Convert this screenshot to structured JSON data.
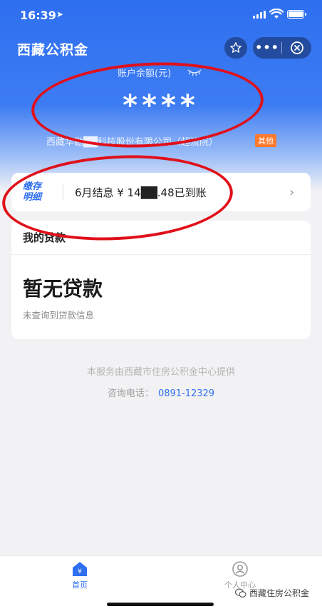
{
  "status_bar": {
    "time": "16:39",
    "location_glyph": "➤"
  },
  "header": {
    "title": "西藏公积金",
    "more_label": "•••"
  },
  "balance": {
    "label": "账户余额(元)",
    "value": "****",
    "company": "西藏华勘██科技股份有限公司（超流院）",
    "tag": "其他"
  },
  "deposit": {
    "badge_line1": "缴存",
    "badge_line2": "明细",
    "text": "6月结息 ¥ 14██.48已到账",
    "chevron": "›"
  },
  "loan": {
    "title": "我的贷款",
    "status": "暂无贷款",
    "subtitle": "未查询到贷款信息"
  },
  "footer": {
    "line1": "本服务由西藏市住房公积金中心提供",
    "phone_label": "咨询电话：",
    "phone": "0891-12329"
  },
  "tabbar": {
    "home_label": "首页",
    "profile_label": "个人中心"
  },
  "watermark": {
    "text": "西藏住房公积金"
  },
  "colors": {
    "brand": "#2e6ff0",
    "annotation": "#e0101a",
    "tag": "#ff7a2e"
  }
}
